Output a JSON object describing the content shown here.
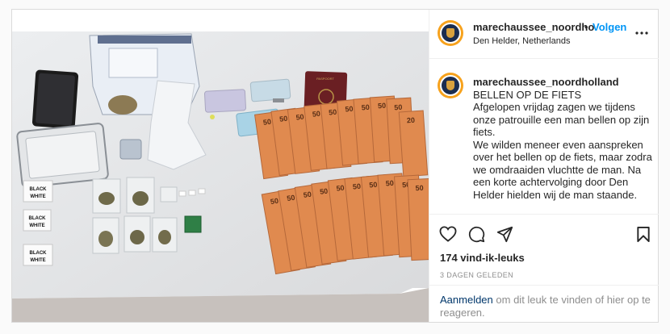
{
  "post": {
    "username_header": "marechaussee_noordho",
    "separator": "•",
    "follow_label": "Volgen",
    "location": "Den Helder, Netherlands",
    "caption_username": "marechaussee_noordholland",
    "caption_title": "BELLEN OP DE FIETS",
    "caption_p1": "Afgelopen vrijdag zagen we tijdens onze patrouille een man bellen op zijn fiets.",
    "caption_p2": "We wilden meneer even aanspreken over het bellen op de fiets, maar zodra we omdraaiden vluchtte de man. Na een korte achtervolging door Den Helder hielden wij de man staande.",
    "likes": "174 vind-ik-leuks",
    "timestamp": "3 DAGEN GELEDEN",
    "login_link": "Aanmelden",
    "login_text": "om dit leuk te vinden of hier op te reageren."
  },
  "photo": {
    "label_text": "BLACK WHITE",
    "passport_text": "PASPOORT",
    "banknote_value": "50",
    "banknote_value_small": "20"
  },
  "icons": [
    "more-icon",
    "heart-icon",
    "comment-icon",
    "share-icon",
    "bookmark-icon"
  ],
  "colors": {
    "accent": "#0095f6",
    "avatar_ring": "#f7a21d",
    "banknote": "#e08a4f"
  }
}
